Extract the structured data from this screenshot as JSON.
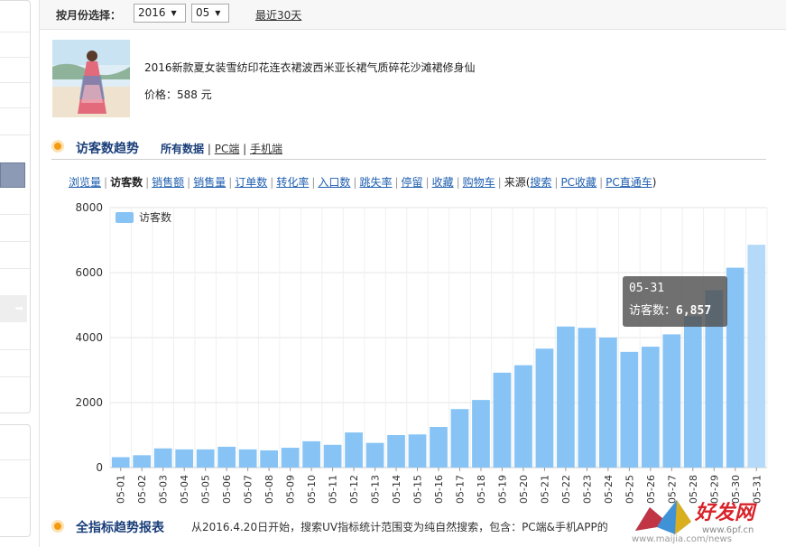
{
  "filter": {
    "month_label": "按月份选择：",
    "year": "2016",
    "month": "05",
    "last30_label": "最近30天"
  },
  "product": {
    "title": "2016新款夏女装雪纺印花连衣裙波西米亚长裙气质碎花沙滩裙修身仙",
    "price": "价格：588 元"
  },
  "visitor_section": {
    "title": "访客数趋势",
    "tabs": [
      {
        "label": "所有数据",
        "active": true
      },
      {
        "label": "PC端",
        "active": false
      },
      {
        "label": "手机端",
        "active": false
      }
    ]
  },
  "metrics": {
    "items": [
      {
        "label": "浏览量",
        "active": false
      },
      {
        "label": "访客数",
        "active": true
      },
      {
        "label": "销售额",
        "active": false
      },
      {
        "label": "销售量",
        "active": false
      },
      {
        "label": "订单数",
        "active": false
      },
      {
        "label": "转化率",
        "active": false
      },
      {
        "label": "入口数",
        "active": false
      },
      {
        "label": "跳失率",
        "active": false
      },
      {
        "label": "停留",
        "active": false
      },
      {
        "label": "收藏",
        "active": false
      },
      {
        "label": "购物车",
        "active": false
      }
    ],
    "source_prefix": "来源(",
    "sources": [
      "搜索",
      "PC收藏",
      "PC直通车"
    ],
    "source_suffix": ")"
  },
  "chart_data": {
    "type": "bar",
    "legend": [
      "访客数"
    ],
    "categories": [
      "05-01",
      "05-02",
      "05-03",
      "05-04",
      "05-05",
      "05-06",
      "05-07",
      "05-08",
      "05-09",
      "05-10",
      "05-11",
      "05-12",
      "05-13",
      "05-14",
      "05-15",
      "05-16",
      "05-17",
      "05-18",
      "05-19",
      "05-20",
      "05-21",
      "05-22",
      "05-23",
      "05-24",
      "05-25",
      "05-26",
      "05-27",
      "05-28",
      "05-29",
      "05-30",
      "05-31"
    ],
    "series": [
      {
        "name": "访客数",
        "values": [
          320,
          380,
          590,
          560,
          560,
          640,
          560,
          530,
          610,
          810,
          700,
          1080,
          760,
          1000,
          1020,
          1250,
          1800,
          2080,
          2920,
          3150,
          3660,
          4340,
          4300,
          4000,
          3560,
          3720,
          4100,
          4660,
          5460,
          6150,
          6857
        ]
      }
    ],
    "ylim": [
      0,
      8000
    ],
    "yticks": [
      0,
      2000,
      4000,
      6000,
      8000
    ],
    "grid": true,
    "legend_position": "top-left",
    "bar_color": "#87c4f5",
    "highlight_color": "#b5d9f8",
    "highlight_index": 30,
    "tooltip": {
      "date": "05-31",
      "label": "访客数：",
      "value": "6,857"
    }
  },
  "bottom_section": {
    "title": "全指标趋势报表",
    "note": "从2016.4.20日开始，搜索UV指标统计范围变为纯自然搜索，包含：PC端&手机APP的"
  },
  "watermark": {
    "text": "好发网",
    "url": "www.6pf.cn",
    "url2": "www.maijia.com/news"
  }
}
